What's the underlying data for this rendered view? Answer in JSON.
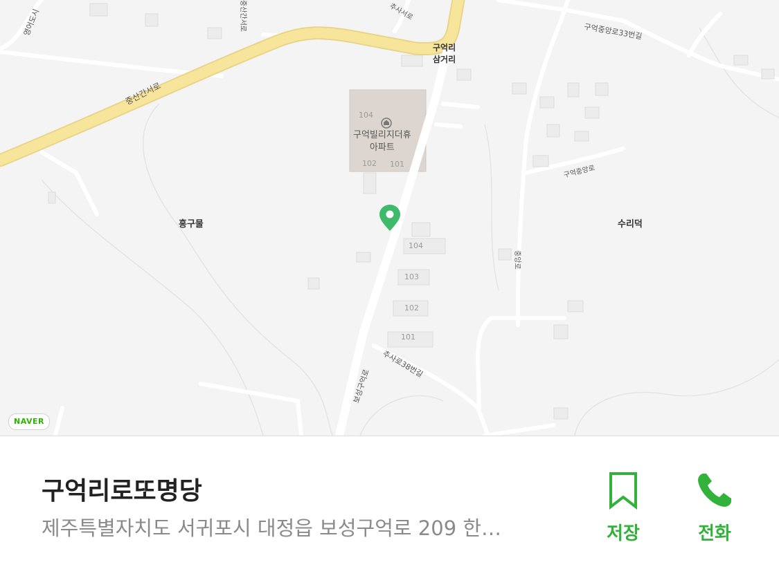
{
  "map": {
    "brand_badge": "NAVER",
    "marker_color": "#3fb96a",
    "area_labels": [
      "흥구물",
      "수리덕"
    ],
    "junction_label_line1": "구억리",
    "junction_label_line2": "삼거리",
    "poi": {
      "name_line1": "구억빌리지더휴",
      "name_line2": "아파트",
      "icon": "apartment-icon"
    },
    "building_numbers": [
      "104",
      "102",
      "101",
      "104",
      "103",
      "102",
      "101"
    ],
    "road_labels": [
      "중산간서로",
      "구억중앙로33번길",
      "구억중앙로",
      "보성구억로",
      "추사로38번길",
      "중산간서로",
      "영어도시",
      "추사서로",
      "중앙로"
    ],
    "colors": {
      "main_road": "#f7e59b",
      "minor_road": "#ffffff",
      "background": "#f4f4f4"
    }
  },
  "place": {
    "title": "구억리로또명당",
    "address": "제주특별자치도 서귀포시 대정읍 보성구억로 209 한…"
  },
  "actions": {
    "save_label": "저장",
    "call_label": "전화",
    "save_icon": "bookmark-icon",
    "call_icon": "phone-icon",
    "accent_color": "#32b23a"
  }
}
